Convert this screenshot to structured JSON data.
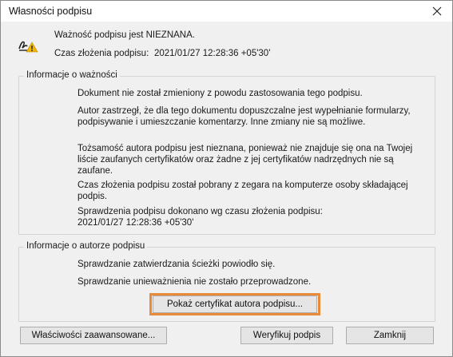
{
  "dialog": {
    "title": "Własności podpisu",
    "summary": {
      "validity_text": "Ważność podpisu jest NIEZNANA.",
      "signing_time_label": "Czas złożenia podpisu:",
      "signing_time_value": "2021/01/27 12:28:36 +05'30'"
    },
    "validity_group": {
      "label": "Informacje o ważności",
      "paragraphs": [
        "Dokument nie został zmieniony z powodu zastosowania tego podpisu.",
        "Autor zastrzegł, że dla tego dokumentu dopuszczalne jest wypełnianie formularzy, podpisywanie i umieszczanie komentarzy. Inne zmiany nie są możliwe.",
        "Tożsamość autora podpisu jest nieznana, ponieważ nie znajduje się ona na Twojej liście zaufanych certyfikatów oraz żadne z jej certyfikatów nadrzędnych nie są zaufane.",
        "Czas złożenia podpisu został pobrany z zegara na komputerze osoby składającej podpis.",
        "Sprawdzenia podpisu dokonano wg czasu złożenia podpisu:\n2021/01/27 12:28:36 +05'30'"
      ]
    },
    "author_group": {
      "label": "Informacje o autorze podpisu",
      "lines": [
        "Sprawdzanie zatwierdzania ścieżki powiodło się.",
        "Sprawdzanie unieważnienia nie zostało przeprowadzone."
      ],
      "show_certificate_button": "Pokaż certyfikat autora podpisu..."
    },
    "buttons": {
      "advanced": "Właściwości zaawansowane...",
      "verify": "Weryfikuj podpis",
      "close": "Zamknij"
    },
    "colors": {
      "highlight": "#e98a3b",
      "warning": "#f2b600"
    }
  }
}
